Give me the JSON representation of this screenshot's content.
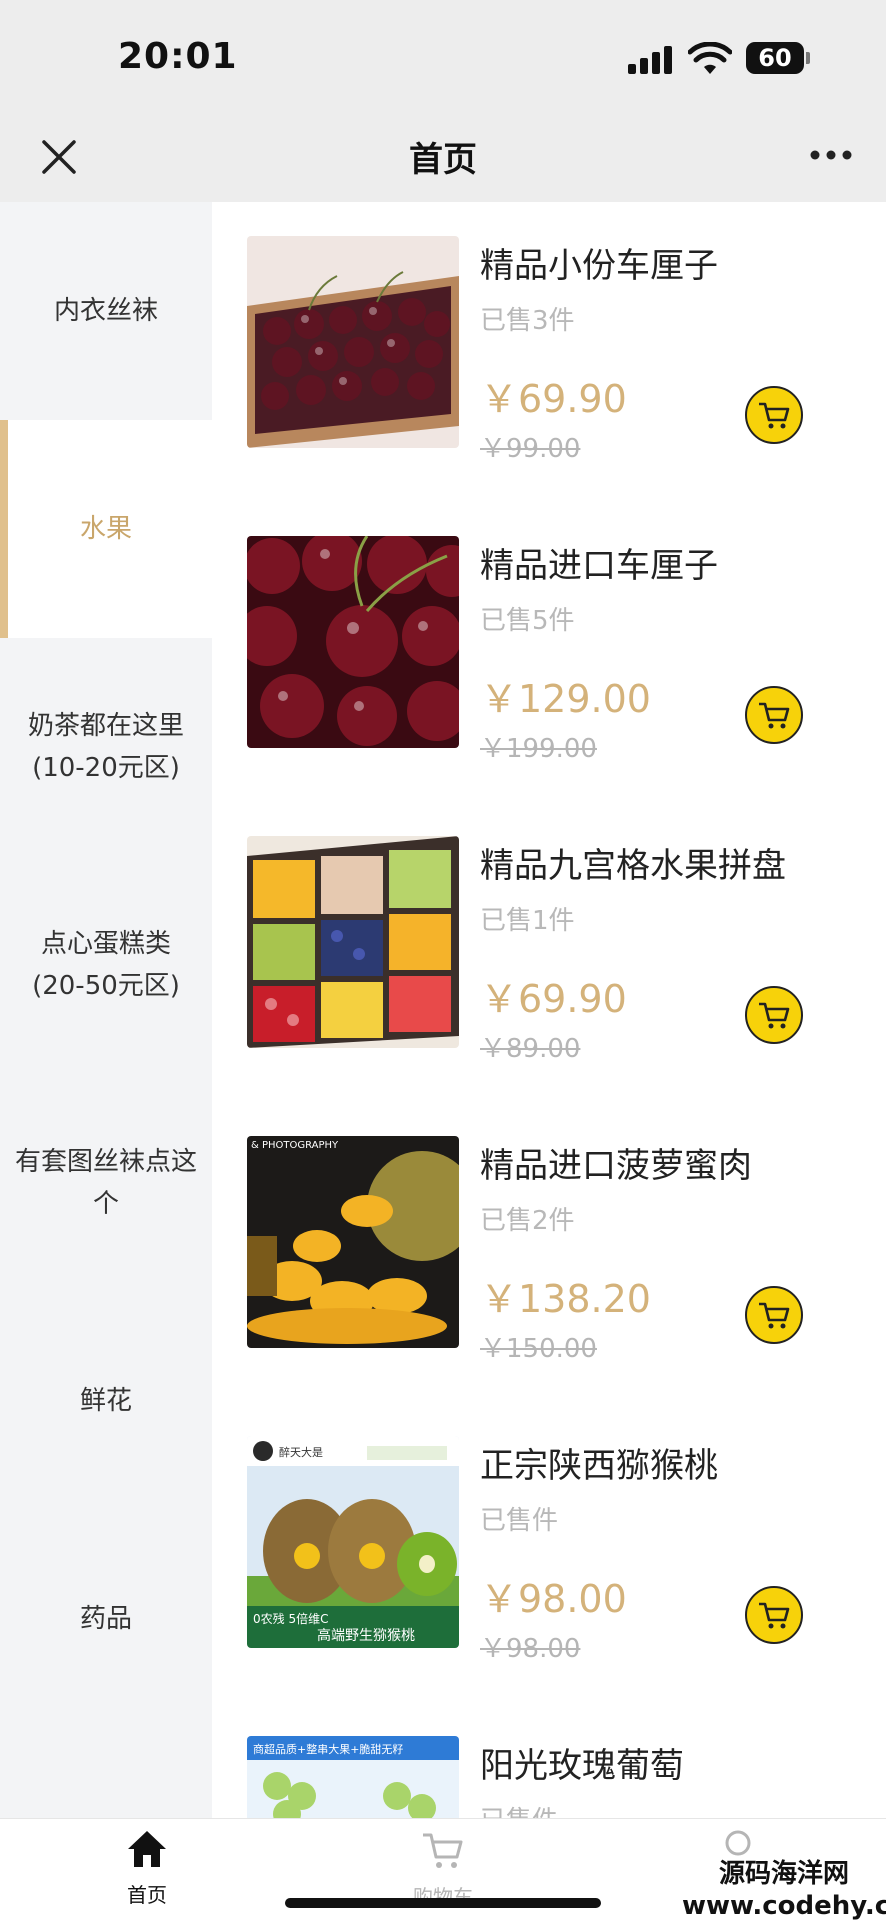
{
  "status": {
    "time": "20:01",
    "battery": "60"
  },
  "nav": {
    "title": "首页"
  },
  "categories": [
    {
      "label": "内衣丝袜"
    },
    {
      "label": "水果"
    },
    {
      "label": "奶茶都在这里\n(10-20元区)"
    },
    {
      "label": "点心蛋糕类\n(20-50元区)"
    },
    {
      "label": "有套图丝袜点这个"
    },
    {
      "label": "鲜花"
    },
    {
      "label": "药品"
    }
  ],
  "products": [
    {
      "name": "精品小份车厘子",
      "sold": "已售3件",
      "price": "￥69.90",
      "original_price": "￥99.00"
    },
    {
      "name": "精品进口车厘子",
      "sold": "已售5件",
      "price": "￥129.00",
      "original_price": "￥199.00"
    },
    {
      "name": "精品九宫格水果拼盘",
      "sold": "已售1件",
      "price": "￥69.90",
      "original_price": "￥89.00"
    },
    {
      "name": "精品进口菠萝蜜肉",
      "sold": "已售2件",
      "price": "￥138.20",
      "original_price": "￥150.00",
      "image_caption": "& PHOTOGRAPHY"
    },
    {
      "name": "正宗陕西猕猴桃",
      "sold": "已售件",
      "price": "￥98.00",
      "original_price": "￥98.00",
      "image_brand": "醉天大是",
      "image_badge": "0农残 5倍维C",
      "image_slogan": "高端野生猕猴桃"
    },
    {
      "name": "阳光玫瑰葡萄",
      "sold": "已售件",
      "image_banner": "商超品质+整串大果+脆甜无籽"
    }
  ],
  "tabbar": {
    "home": "首页",
    "cart": "购物车"
  },
  "watermark": {
    "title": "源码海洋网",
    "url": "www.codehy.com"
  },
  "colors": {
    "accent": "#c9a66b",
    "price": "#d4b27a",
    "cart_button": "#f7d20a",
    "sidebar_bg": "#f3f4f6",
    "header_bg": "#ededed"
  }
}
